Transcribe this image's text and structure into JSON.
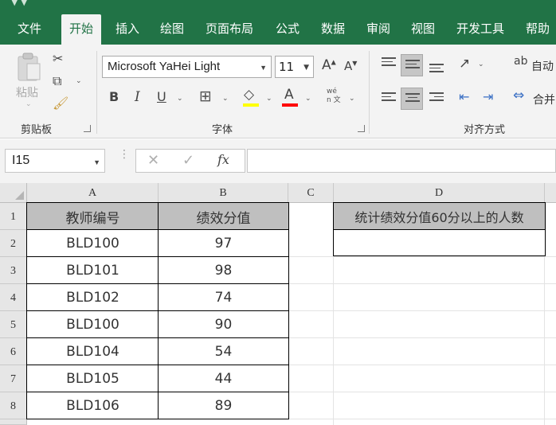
{
  "ribbon": {
    "tabs": [
      "文件",
      "开始",
      "插入",
      "绘图",
      "页面布局",
      "公式",
      "数据",
      "审阅",
      "视图",
      "开发工具",
      "帮助"
    ],
    "active_tab": "开始",
    "clipboard": {
      "paste_label": "粘贴",
      "group_label": "剪贴板"
    },
    "font": {
      "name": "Microsoft YaHei Light",
      "size": "11",
      "group_label": "字体",
      "phonetic_glyph": "wén 文",
      "highlight_color": "#ffff00",
      "font_color": "#ff0000"
    },
    "alignment": {
      "group_label": "对齐方式",
      "wrap_label": "自动",
      "merge_label": "合并"
    }
  },
  "formula_bar": {
    "name_box": "I15",
    "formula": ""
  },
  "sheet": {
    "columns": [
      "A",
      "B",
      "C",
      "D"
    ],
    "rows": [
      "1",
      "2",
      "3",
      "4",
      "5",
      "6",
      "7",
      "8"
    ],
    "table_headers": [
      "教师编号",
      "绩效分值"
    ],
    "table_rows": [
      [
        "BLD100",
        "97"
      ],
      [
        "BLD101",
        "98"
      ],
      [
        "BLD102",
        "74"
      ],
      [
        "BLD100",
        "90"
      ],
      [
        "BLD104",
        "54"
      ],
      [
        "BLD105",
        "44"
      ],
      [
        "BLD106",
        "89"
      ]
    ],
    "d1": "统计绩效分值60分以上的人数",
    "d2": ""
  },
  "colors": {
    "accent": "#217346",
    "header_fill": "#bfbfbf"
  }
}
